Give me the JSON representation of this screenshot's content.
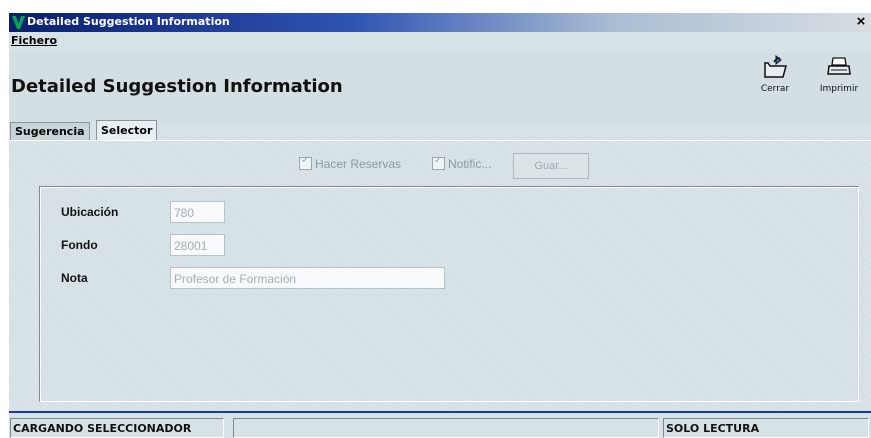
{
  "window": {
    "title": "Detailed Suggestion Information",
    "close_glyph": "×"
  },
  "menu": {
    "items": [
      {
        "label": "Fichero"
      }
    ]
  },
  "header": {
    "title": "Detailed Suggestion Information",
    "actions": [
      {
        "label": "Cerrar",
        "icon": "folder-close-icon"
      },
      {
        "label": "Imprimir",
        "icon": "printer-icon"
      }
    ]
  },
  "tabs": [
    {
      "label": "Sugerencia",
      "active": false
    },
    {
      "label": "Selector",
      "active": true
    }
  ],
  "toolbar": {
    "hacer_reservas": {
      "label": "Hacer Reservas",
      "checked": true,
      "disabled": true
    },
    "notific": {
      "label": "Notific...",
      "checked": true,
      "disabled": true
    },
    "guardar": {
      "label": "Guar...",
      "disabled": true
    }
  },
  "form": {
    "ubicacion": {
      "label": "Ubicación",
      "value": "780"
    },
    "fondo": {
      "label": "Fondo",
      "value": "28001"
    },
    "nota": {
      "label": "Nota",
      "value": "Profesor de Formación"
    }
  },
  "status": {
    "left": "CARGANDO SELECCIONADOR",
    "middle": "",
    "right": "SOLO LECTURA"
  },
  "colors": {
    "titlebar": "#0a1e6e",
    "background": "#d7e2e6",
    "status_accent": "#1a3c8e"
  }
}
